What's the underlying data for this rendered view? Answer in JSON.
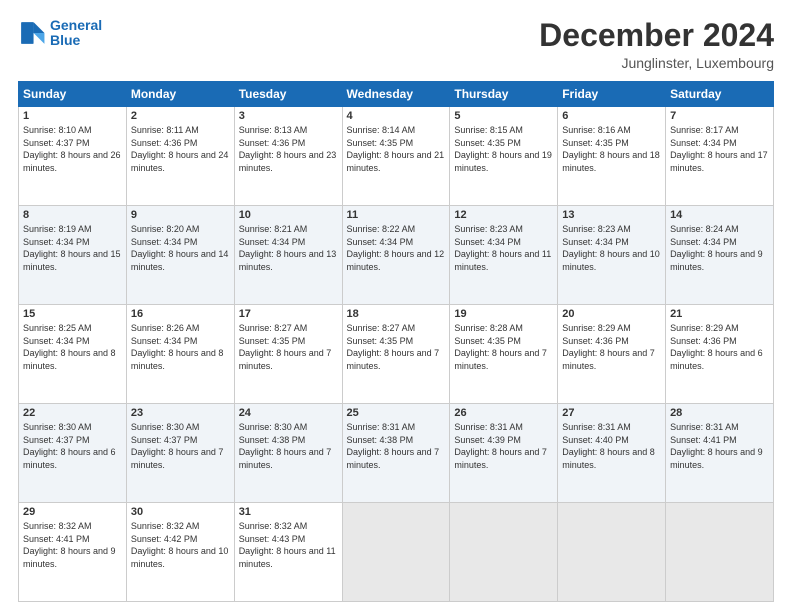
{
  "logo": {
    "line1": "General",
    "line2": "Blue"
  },
  "title": "December 2024",
  "subtitle": "Junglinster, Luxembourg",
  "weekdays": [
    "Sunday",
    "Monday",
    "Tuesday",
    "Wednesday",
    "Thursday",
    "Friday",
    "Saturday"
  ],
  "weeks": [
    [
      {
        "day": "1",
        "sunrise": "8:10 AM",
        "sunset": "4:37 PM",
        "daylight": "8 hours and 26 minutes."
      },
      {
        "day": "2",
        "sunrise": "8:11 AM",
        "sunset": "4:36 PM",
        "daylight": "8 hours and 24 minutes."
      },
      {
        "day": "3",
        "sunrise": "8:13 AM",
        "sunset": "4:36 PM",
        "daylight": "8 hours and 23 minutes."
      },
      {
        "day": "4",
        "sunrise": "8:14 AM",
        "sunset": "4:35 PM",
        "daylight": "8 hours and 21 minutes."
      },
      {
        "day": "5",
        "sunrise": "8:15 AM",
        "sunset": "4:35 PM",
        "daylight": "8 hours and 19 minutes."
      },
      {
        "day": "6",
        "sunrise": "8:16 AM",
        "sunset": "4:35 PM",
        "daylight": "8 hours and 18 minutes."
      },
      {
        "day": "7",
        "sunrise": "8:17 AM",
        "sunset": "4:34 PM",
        "daylight": "8 hours and 17 minutes."
      }
    ],
    [
      {
        "day": "8",
        "sunrise": "8:19 AM",
        "sunset": "4:34 PM",
        "daylight": "8 hours and 15 minutes."
      },
      {
        "day": "9",
        "sunrise": "8:20 AM",
        "sunset": "4:34 PM",
        "daylight": "8 hours and 14 minutes."
      },
      {
        "day": "10",
        "sunrise": "8:21 AM",
        "sunset": "4:34 PM",
        "daylight": "8 hours and 13 minutes."
      },
      {
        "day": "11",
        "sunrise": "8:22 AM",
        "sunset": "4:34 PM",
        "daylight": "8 hours and 12 minutes."
      },
      {
        "day": "12",
        "sunrise": "8:23 AM",
        "sunset": "4:34 PM",
        "daylight": "8 hours and 11 minutes."
      },
      {
        "day": "13",
        "sunrise": "8:23 AM",
        "sunset": "4:34 PM",
        "daylight": "8 hours and 10 minutes."
      },
      {
        "day": "14",
        "sunrise": "8:24 AM",
        "sunset": "4:34 PM",
        "daylight": "8 hours and 9 minutes."
      }
    ],
    [
      {
        "day": "15",
        "sunrise": "8:25 AM",
        "sunset": "4:34 PM",
        "daylight": "8 hours and 8 minutes."
      },
      {
        "day": "16",
        "sunrise": "8:26 AM",
        "sunset": "4:34 PM",
        "daylight": "8 hours and 8 minutes."
      },
      {
        "day": "17",
        "sunrise": "8:27 AM",
        "sunset": "4:35 PM",
        "daylight": "8 hours and 7 minutes."
      },
      {
        "day": "18",
        "sunrise": "8:27 AM",
        "sunset": "4:35 PM",
        "daylight": "8 hours and 7 minutes."
      },
      {
        "day": "19",
        "sunrise": "8:28 AM",
        "sunset": "4:35 PM",
        "daylight": "8 hours and 7 minutes."
      },
      {
        "day": "20",
        "sunrise": "8:29 AM",
        "sunset": "4:36 PM",
        "daylight": "8 hours and 7 minutes."
      },
      {
        "day": "21",
        "sunrise": "8:29 AM",
        "sunset": "4:36 PM",
        "daylight": "8 hours and 6 minutes."
      }
    ],
    [
      {
        "day": "22",
        "sunrise": "8:30 AM",
        "sunset": "4:37 PM",
        "daylight": "8 hours and 6 minutes."
      },
      {
        "day": "23",
        "sunrise": "8:30 AM",
        "sunset": "4:37 PM",
        "daylight": "8 hours and 7 minutes."
      },
      {
        "day": "24",
        "sunrise": "8:30 AM",
        "sunset": "4:38 PM",
        "daylight": "8 hours and 7 minutes."
      },
      {
        "day": "25",
        "sunrise": "8:31 AM",
        "sunset": "4:38 PM",
        "daylight": "8 hours and 7 minutes."
      },
      {
        "day": "26",
        "sunrise": "8:31 AM",
        "sunset": "4:39 PM",
        "daylight": "8 hours and 7 minutes."
      },
      {
        "day": "27",
        "sunrise": "8:31 AM",
        "sunset": "4:40 PM",
        "daylight": "8 hours and 8 minutes."
      },
      {
        "day": "28",
        "sunrise": "8:31 AM",
        "sunset": "4:41 PM",
        "daylight": "8 hours and 9 minutes."
      }
    ],
    [
      {
        "day": "29",
        "sunrise": "8:32 AM",
        "sunset": "4:41 PM",
        "daylight": "8 hours and 9 minutes."
      },
      {
        "day": "30",
        "sunrise": "8:32 AM",
        "sunset": "4:42 PM",
        "daylight": "8 hours and 10 minutes."
      },
      {
        "day": "31",
        "sunrise": "8:32 AM",
        "sunset": "4:43 PM",
        "daylight": "8 hours and 11 minutes."
      },
      null,
      null,
      null,
      null
    ]
  ]
}
